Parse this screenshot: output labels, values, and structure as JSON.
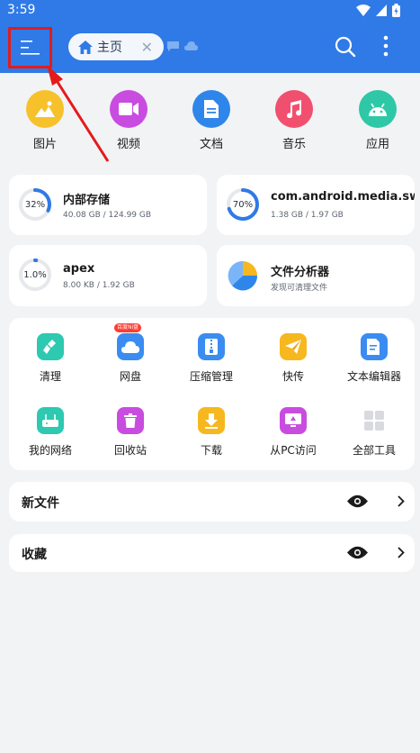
{
  "status_bar": {
    "time": "3:59"
  },
  "app_bar": {
    "menu_icon": "menu-icon",
    "home_tab_label": "主页",
    "colors": {
      "primary": "#2f7ae6",
      "highlight": "#e41b1b"
    }
  },
  "categories": [
    {
      "label": "图片",
      "icon": "image-icon",
      "color": "#f6c12b"
    },
    {
      "label": "视频",
      "icon": "video-icon",
      "color": "#c94ce0"
    },
    {
      "label": "文档",
      "icon": "document-icon",
      "color": "#2f86ea"
    },
    {
      "label": "音乐",
      "icon": "music-icon",
      "color": "#f0506e"
    },
    {
      "label": "应用",
      "icon": "android-icon",
      "color": "#2ec8a6"
    }
  ],
  "storage": [
    {
      "title": "内部存储",
      "subtitle": "40.08 GB / 124.99 GB",
      "percent_label": "32%",
      "fraction": 0.32
    },
    {
      "title": "com.android.media.swc...",
      "subtitle": "1.38 GB / 1.97 GB",
      "percent_label": "70%",
      "fraction": 0.7
    },
    {
      "title": "apex",
      "subtitle": "8.00 KB / 1.92 GB",
      "percent_label": "1.0%",
      "fraction": 0.01
    },
    {
      "title": "文件分析器",
      "subtitle": "发现可清理文件"
    }
  ],
  "tools": [
    {
      "label": "清理",
      "icon": "broom-icon",
      "color": "#2dc9b0"
    },
    {
      "label": "网盘",
      "icon": "cloud-icon",
      "color": "#3a8cf0",
      "badge": "百度Ni盘"
    },
    {
      "label": "压缩管理",
      "icon": "zip-icon",
      "color": "#3a8cf0"
    },
    {
      "label": "快传",
      "icon": "send-icon",
      "color": "#f6b81e"
    },
    {
      "label": "文本编辑器",
      "icon": "text-edit-icon",
      "color": "#3a8cf0"
    },
    {
      "label": "我的网络",
      "icon": "router-icon",
      "color": "#2dc9b0"
    },
    {
      "label": "回收站",
      "icon": "trash-icon",
      "color": "#c94ce0"
    },
    {
      "label": "下载",
      "icon": "download-icon",
      "color": "#f6b81e"
    },
    {
      "label": "从PC访问",
      "icon": "pc-access-icon",
      "color": "#c94ce0"
    },
    {
      "label": "全部工具",
      "icon": "grid-icon",
      "color": "#d8dade"
    }
  ],
  "sections": [
    {
      "label": "新文件"
    },
    {
      "label": "收藏"
    }
  ]
}
